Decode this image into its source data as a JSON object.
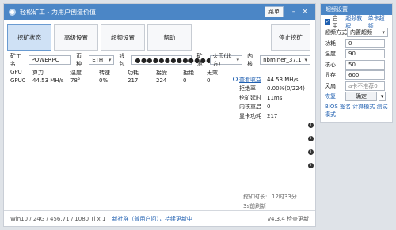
{
  "main": {
    "title": "轻松矿工 - 为用户创造价值",
    "menu_label": "菜单",
    "window_controls": {
      "minimize": "–",
      "close": "×"
    },
    "tabs": [
      "挖矿状态",
      "高级设置",
      "超频设置",
      "帮助"
    ],
    "stop_label": "停止挖矿",
    "config": {
      "worker_label": "矿工名",
      "worker_value": "POWERPC",
      "coin_label": "币种",
      "coin_value": "ETH",
      "wallet_label": "钱包",
      "wallet_value": "●●●●●●●●●●●●●●●",
      "pool_label": "矿池",
      "pool_value": "火币(北方)",
      "kernel_label": "内核",
      "kernel_value": "nbminer_37.1"
    },
    "stats": {
      "headers": [
        "GPU",
        "算力",
        "温度",
        "转速",
        "功耗",
        "接受",
        "拒绝",
        "无效"
      ],
      "row": [
        "GPU0",
        "44.53 MH/s",
        "78°",
        "0%",
        "217",
        "224",
        "0",
        "0"
      ]
    },
    "right_panel": {
      "link_label": "查看收益",
      "hashrate": "44.53 MH/s",
      "reject_rate_label": "拒绝率",
      "reject_rate": "0.00%(0/224)",
      "latency_label": "挖矿延时",
      "latency": "11ms",
      "restart_label": "内核重启",
      "restart": "0",
      "power_label": "显卡功耗",
      "power": "217"
    },
    "side_icons": [
      "i",
      "i",
      "i",
      "i"
    ],
    "mining_time_label": "挖矿时长:",
    "mining_time": "12时33分",
    "last_update": "3s前刷新",
    "status": {
      "sysinfo": "Win10 / 24G / 456.71 / 1080 Ti x 1",
      "notice": "新社群（普用户问），持续更新中",
      "version": "v4.3.4 检查更新"
    }
  },
  "overclock": {
    "title": "超频设置",
    "enable_label": "启用",
    "tutorial_link": "超频教程",
    "single_card_link": "单卡超频",
    "mode_label": "超频方式",
    "mode_value": "内置超频",
    "fields": [
      {
        "label": "功耗",
        "value": "0"
      },
      {
        "label": "温度",
        "value": "90"
      },
      {
        "label": "核心",
        "value": "50"
      },
      {
        "label": "显存",
        "value": "600"
      },
      {
        "label": "风扇",
        "value": "a卡不推荐0"
      }
    ],
    "restore_label": "恢复",
    "confirm_label": "确定",
    "footer_links": "BIOS 签名 计算模式 测试模式"
  }
}
